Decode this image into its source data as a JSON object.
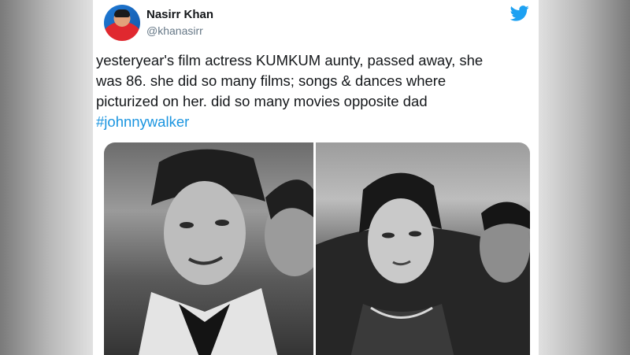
{
  "tweet": {
    "author_name": "Nasirr Khan",
    "author_handle": "@khanasirr",
    "text_lines": [
      "yesteryear's film actress KUMKUM aunty, passed away, she",
      "was 86. she did so many films; songs & dances where",
      "picturized on her. did so many movies opposite dad"
    ],
    "hashtag": "#johnnywalker",
    "icon": "twitter-bird-icon",
    "colors": {
      "accent": "#1da1f2",
      "hashtag": "#1b95e0",
      "text": "#14171a",
      "muted": "#657786"
    }
  }
}
